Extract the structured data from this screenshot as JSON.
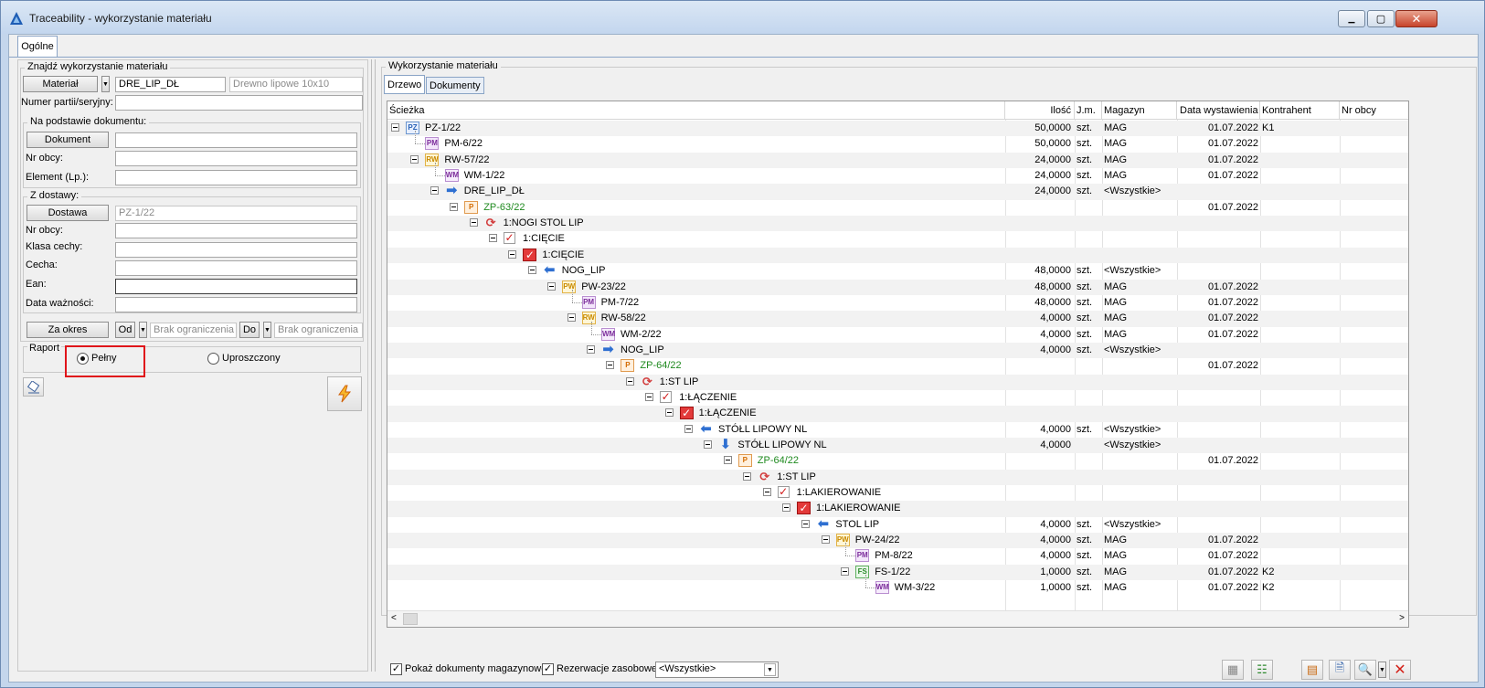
{
  "window": {
    "title": "Traceability - wykorzystanie materiału",
    "minimize": "▁",
    "maximize": "▢",
    "close": "✕"
  },
  "tabs": {
    "main": "Ogólne"
  },
  "left": {
    "group_find": "Znajdź wykorzystanie materiału",
    "material_button": "Materiał",
    "material_code": "DRE_LIP_DŁ",
    "material_name": "Drewno lipowe 10x10",
    "batch_label": "Numer partii/seryjny:",
    "batch_value": "",
    "group_doc": "Na podstawie dokumentu:",
    "doc_button": "Dokument",
    "doc_value": "",
    "foreign_no_label": "Nr obcy:",
    "foreign_no_value": "",
    "element_label": "Element (Lp.):",
    "element_value": "",
    "group_delivery": "Z dostawy:",
    "delivery_button": "Dostawa",
    "delivery_value": "PZ-1/22",
    "delivery_foreign_no_label": "Nr obcy:",
    "delivery_foreign_no_value": "",
    "feature_class_label": "Klasa cechy:",
    "feature_class_value": "",
    "feature_label": "Cecha:",
    "feature_value": "",
    "ean_label": "Ean:",
    "ean_value": "",
    "expiry_label": "Data ważności:",
    "expiry_value": "",
    "period_button": "Za okres",
    "from_button": "Od",
    "from_value": "Brak ograniczenia",
    "to_button": "Do",
    "to_value": "Brak ograniczenia",
    "report_label": "Raport",
    "report_full": "Pełny",
    "report_simple": "Uproszczony",
    "report_selected": "Pełny"
  },
  "right": {
    "group_title": "Wykorzystanie materiału",
    "tab_tree": "Drzewo",
    "tab_docs": "Dokumenty",
    "columns": [
      "Ścieżka",
      "Ilość",
      "J.m.",
      "Magazyn",
      "Data wystawienia",
      "Kontrahent",
      "Nr obcy"
    ],
    "rows": [
      {
        "depth": 0,
        "icon": "pz",
        "label": "PZ-1/22",
        "qty": "50,0000",
        "unit": "szt.",
        "wh": "MAG",
        "date": "01.07.2022",
        "party": "K1",
        "expand": true
      },
      {
        "depth": 1,
        "icon": "pm",
        "label": "PM-6/22",
        "qty": "50,0000",
        "unit": "szt.",
        "wh": "MAG",
        "date": "01.07.2022",
        "party": "",
        "expand": false
      },
      {
        "depth": 1,
        "icon": "rw",
        "label": "RW-57/22",
        "qty": "24,0000",
        "unit": "szt.",
        "wh": "MAG",
        "date": "01.07.2022",
        "party": "",
        "expand": true
      },
      {
        "depth": 2,
        "icon": "wm",
        "label": "WM-1/22",
        "qty": "24,0000",
        "unit": "szt.",
        "wh": "MAG",
        "date": "01.07.2022",
        "party": "",
        "expand": false
      },
      {
        "depth": 2,
        "icon": "arr-r",
        "label": "DRE_LIP_DŁ",
        "qty": "24,0000",
        "unit": "szt.",
        "wh": "<Wszystkie>",
        "date": "",
        "party": "",
        "expand": true
      },
      {
        "depth": 3,
        "icon": "p",
        "label": "ZP-63/22",
        "qty": "",
        "unit": "",
        "wh": "",
        "date": "01.07.2022",
        "party": "",
        "expand": true,
        "green": true
      },
      {
        "depth": 4,
        "icon": "cyc",
        "label": "1:NOGI STOL LIP",
        "qty": "",
        "unit": "",
        "wh": "",
        "date": "",
        "party": "",
        "expand": true
      },
      {
        "depth": 5,
        "icon": "chk",
        "label": "1:CIĘCIE",
        "qty": "",
        "unit": "",
        "wh": "",
        "date": "",
        "party": "",
        "expand": true
      },
      {
        "depth": 6,
        "icon": "chkr",
        "label": "1:CIĘCIE",
        "qty": "",
        "unit": "",
        "wh": "",
        "date": "",
        "party": "",
        "expand": true
      },
      {
        "depth": 7,
        "icon": "arr-l",
        "label": "NOG_LIP",
        "qty": "48,0000",
        "unit": "szt.",
        "wh": "<Wszystkie>",
        "date": "",
        "party": "",
        "expand": true
      },
      {
        "depth": 8,
        "icon": "pw",
        "label": "PW-23/22",
        "qty": "48,0000",
        "unit": "szt.",
        "wh": "MAG",
        "date": "01.07.2022",
        "party": "",
        "expand": true
      },
      {
        "depth": 9,
        "icon": "pm",
        "label": "PM-7/22",
        "qty": "48,0000",
        "unit": "szt.",
        "wh": "MAG",
        "date": "01.07.2022",
        "party": "",
        "expand": false
      },
      {
        "depth": 9,
        "icon": "rw",
        "label": "RW-58/22",
        "qty": "4,0000",
        "unit": "szt.",
        "wh": "MAG",
        "date": "01.07.2022",
        "party": "",
        "expand": true
      },
      {
        "depth": 10,
        "icon": "wm",
        "label": "WM-2/22",
        "qty": "4,0000",
        "unit": "szt.",
        "wh": "MAG",
        "date": "01.07.2022",
        "party": "",
        "expand": false
      },
      {
        "depth": 10,
        "icon": "arr-r",
        "label": "NOG_LIP",
        "qty": "4,0000",
        "unit": "szt.",
        "wh": "<Wszystkie>",
        "date": "",
        "party": "",
        "expand": true
      },
      {
        "depth": 11,
        "icon": "p",
        "label": "ZP-64/22",
        "qty": "",
        "unit": "",
        "wh": "",
        "date": "01.07.2022",
        "party": "",
        "expand": true,
        "green": true
      },
      {
        "depth": 12,
        "icon": "cyc",
        "label": "1:ST LIP",
        "qty": "",
        "unit": "",
        "wh": "",
        "date": "",
        "party": "",
        "expand": true
      },
      {
        "depth": 13,
        "icon": "chk",
        "label": "1:ŁĄCZENIE",
        "qty": "",
        "unit": "",
        "wh": "",
        "date": "",
        "party": "",
        "expand": true
      },
      {
        "depth": 14,
        "icon": "chkr",
        "label": "1:ŁĄCZENIE",
        "qty": "",
        "unit": "",
        "wh": "",
        "date": "",
        "party": "",
        "expand": true
      },
      {
        "depth": 15,
        "icon": "arr-l",
        "label": "STÓŁL LIPOWY NL",
        "qty": "4,0000",
        "unit": "szt.",
        "wh": "<Wszystkie>",
        "date": "",
        "party": "",
        "expand": true
      },
      {
        "depth": 16,
        "icon": "arr-d",
        "label": "STÓŁL LIPOWY NL",
        "qty": "4,0000",
        "unit": "",
        "wh": "<Wszystkie>",
        "date": "",
        "party": "",
        "expand": true
      },
      {
        "depth": 17,
        "icon": "p",
        "label": "ZP-64/22",
        "qty": "",
        "unit": "",
        "wh": "",
        "date": "01.07.2022",
        "party": "",
        "expand": true,
        "green": true
      },
      {
        "depth": 18,
        "icon": "cyc",
        "label": "1:ST LIP",
        "qty": "",
        "unit": "",
        "wh": "",
        "date": "",
        "party": "",
        "expand": true
      },
      {
        "depth": 19,
        "icon": "chk",
        "label": "1:LAKIEROWANIE",
        "qty": "",
        "unit": "",
        "wh": "",
        "date": "",
        "party": "",
        "expand": true
      },
      {
        "depth": 20,
        "icon": "chkr",
        "label": "1:LAKIEROWANIE",
        "qty": "",
        "unit": "",
        "wh": "",
        "date": "",
        "party": "",
        "expand": true
      },
      {
        "depth": 21,
        "icon": "arr-l",
        "label": "STOL LIP",
        "qty": "4,0000",
        "unit": "szt.",
        "wh": "<Wszystkie>",
        "date": "",
        "party": "",
        "expand": true
      },
      {
        "depth": 22,
        "icon": "pw",
        "label": "PW-24/22",
        "qty": "4,0000",
        "unit": "szt.",
        "wh": "MAG",
        "date": "01.07.2022",
        "party": "",
        "expand": true
      },
      {
        "depth": 23,
        "icon": "pm",
        "label": "PM-8/22",
        "qty": "4,0000",
        "unit": "szt.",
        "wh": "MAG",
        "date": "01.07.2022",
        "party": "",
        "expand": false
      },
      {
        "depth": 23,
        "icon": "fs",
        "label": "FS-1/22",
        "qty": "1,0000",
        "unit": "szt.",
        "wh": "MAG",
        "date": "01.07.2022",
        "party": "K2",
        "expand": true
      },
      {
        "depth": 24,
        "icon": "wm",
        "label": "WM-3/22",
        "qty": "1,0000",
        "unit": "szt.",
        "wh": "MAG",
        "date": "01.07.2022",
        "party": "K2",
        "expand": false
      }
    ],
    "show_wh_docs": "Pokaż dokumenty magazynowe",
    "reservations": "Rezerwacje zasobowe",
    "filter_value": "<Wszystkie>"
  }
}
